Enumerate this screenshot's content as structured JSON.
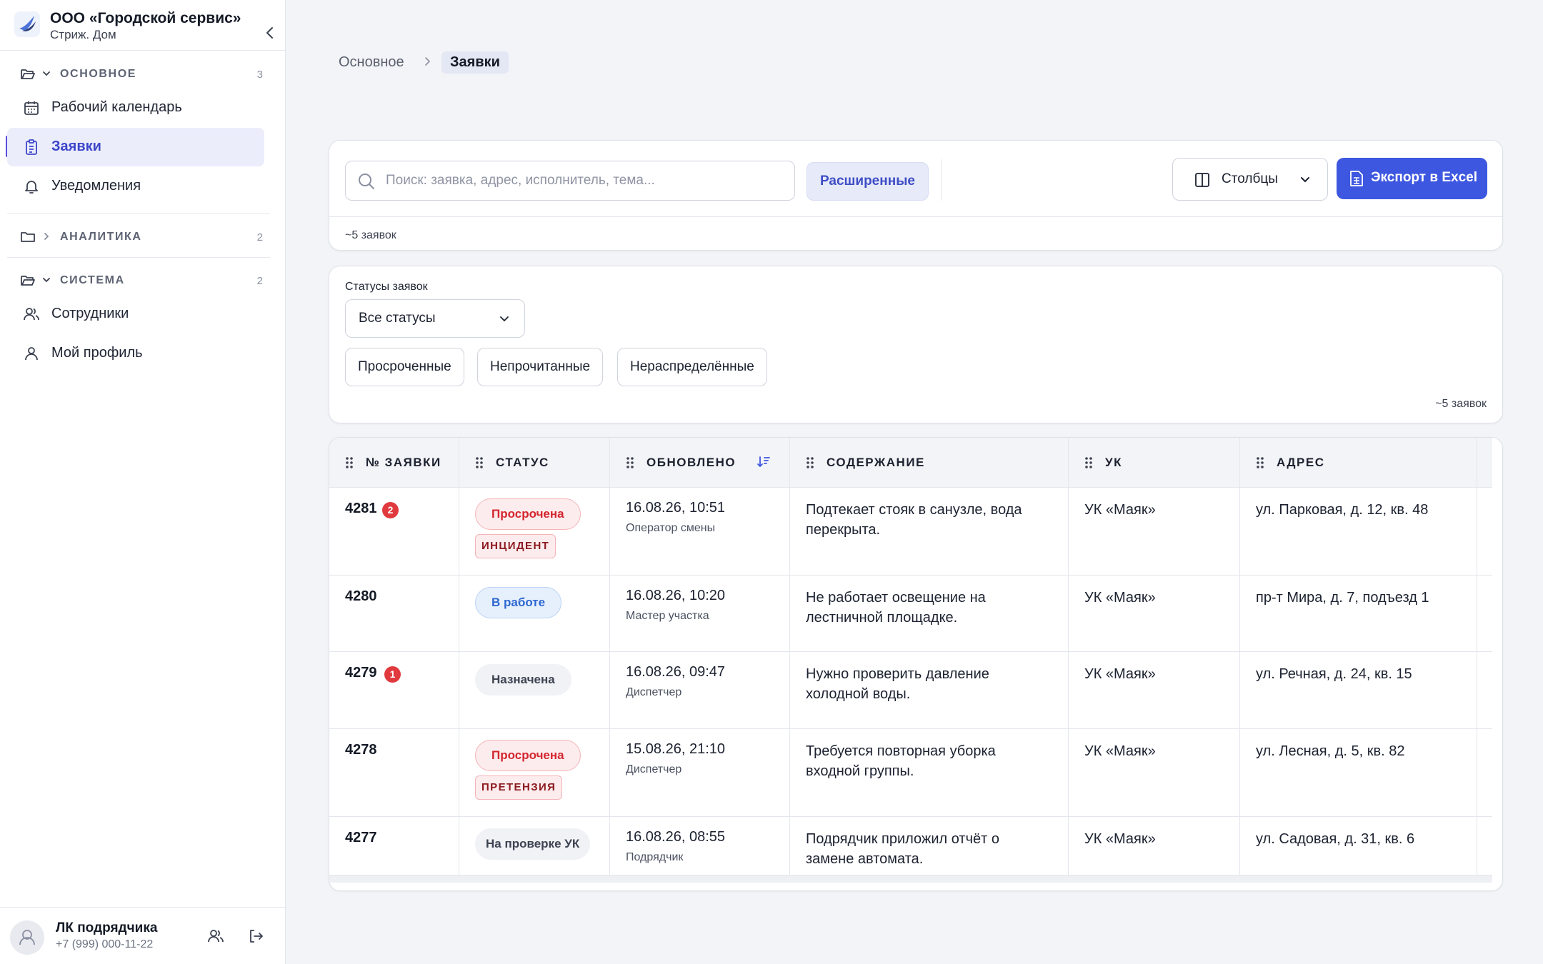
{
  "org": {
    "name": "ООО «Городской сервис»",
    "sub": "Стриж. Дом"
  },
  "sidebar": {
    "groups": [
      {
        "label": "ОСНОВНОЕ",
        "count": "3"
      },
      {
        "label": "АНАЛИТИКА",
        "count": "2"
      },
      {
        "label": "СИСТЕМА",
        "count": "2"
      }
    ],
    "items": [
      {
        "label": "Рабочий календарь",
        "icon": "calendar-icon"
      },
      {
        "label": "Заявки",
        "icon": "clipboard-icon"
      },
      {
        "label": "Уведомления",
        "icon": "bell-icon"
      },
      {
        "label": "Сотрудники",
        "icon": "users-icon"
      },
      {
        "label": "Мой профиль",
        "icon": "user-icon"
      }
    ]
  },
  "user": {
    "name": "ЛК подрядчика",
    "phone": "+7 (999) 000-11-22"
  },
  "breadcrumb": {
    "parent": "Основное",
    "current": "Заявки"
  },
  "search": {
    "placeholder": "Поиск: заявка, адрес, исполнитель, тема...",
    "advanced_label": "Расширенные",
    "columns_label": "Столбцы",
    "export_label": "Экспорт в Excel",
    "count": "~5 заявок"
  },
  "filters": {
    "status_label": "Статусы заявок",
    "status_value": "Все статусы",
    "chips": [
      "Просроченные",
      "Непрочитанные",
      "Нераспределённые"
    ],
    "count": "~5 заявок"
  },
  "table": {
    "columns": [
      "№ ЗАЯВКИ",
      "СТАТУС",
      "ОБНОВЛЕНО",
      "СОДЕРЖАНИЕ",
      "УК",
      "АДРЕС"
    ],
    "rows": [
      {
        "id": "4281",
        "badge": "2",
        "status": "Просрочена",
        "status_color": "red",
        "tag": "ИНЦИДЕНТ",
        "updated": "16.08.26, 10:51",
        "by": "Оператор смены",
        "content": "Подтекает стояк в санузле, вода перекрыта.",
        "uk": "УК «Маяк»",
        "address": "ул. Парковая, д. 12, кв. 48"
      },
      {
        "id": "4280",
        "badge": "",
        "status": "В работе",
        "status_color": "blue",
        "tag": "",
        "updated": "16.08.26, 10:20",
        "by": "Мастер участка",
        "content": "Не работает освещение на лестничной площадке.",
        "uk": "УК «Маяк»",
        "address": "пр-т Мира, д. 7, подъезд 1"
      },
      {
        "id": "4279",
        "badge": "1",
        "status": "Назначена",
        "status_color": "grey",
        "tag": "",
        "updated": "16.08.26, 09:47",
        "by": "Диспетчер",
        "content": "Нужно проверить давление холодной воды.",
        "uk": "УК «Маяк»",
        "address": "ул. Речная, д. 24, кв. 15"
      },
      {
        "id": "4278",
        "badge": "",
        "status": "Просрочена",
        "status_color": "red",
        "tag": "ПРЕТЕНЗИЯ",
        "updated": "15.08.26, 21:10",
        "by": "Диспетчер",
        "content": "Требуется повторная уборка входной группы.",
        "uk": "УК «Маяк»",
        "address": "ул. Лесная, д. 5, кв. 82"
      },
      {
        "id": "4277",
        "badge": "",
        "status": "На проверке УК",
        "status_color": "grey",
        "tag": "",
        "updated": "16.08.26, 08:55",
        "by": "Подрядчик",
        "content": "Подрядчик приложил отчёт о замене автомата.",
        "uk": "УК «Маяк»",
        "address": "ул. Садовая, д. 31, кв. 6"
      }
    ]
  },
  "colors": {
    "accent": "#3d57e0",
    "active_bg": "#ebedfb",
    "danger": "#e0393e"
  }
}
